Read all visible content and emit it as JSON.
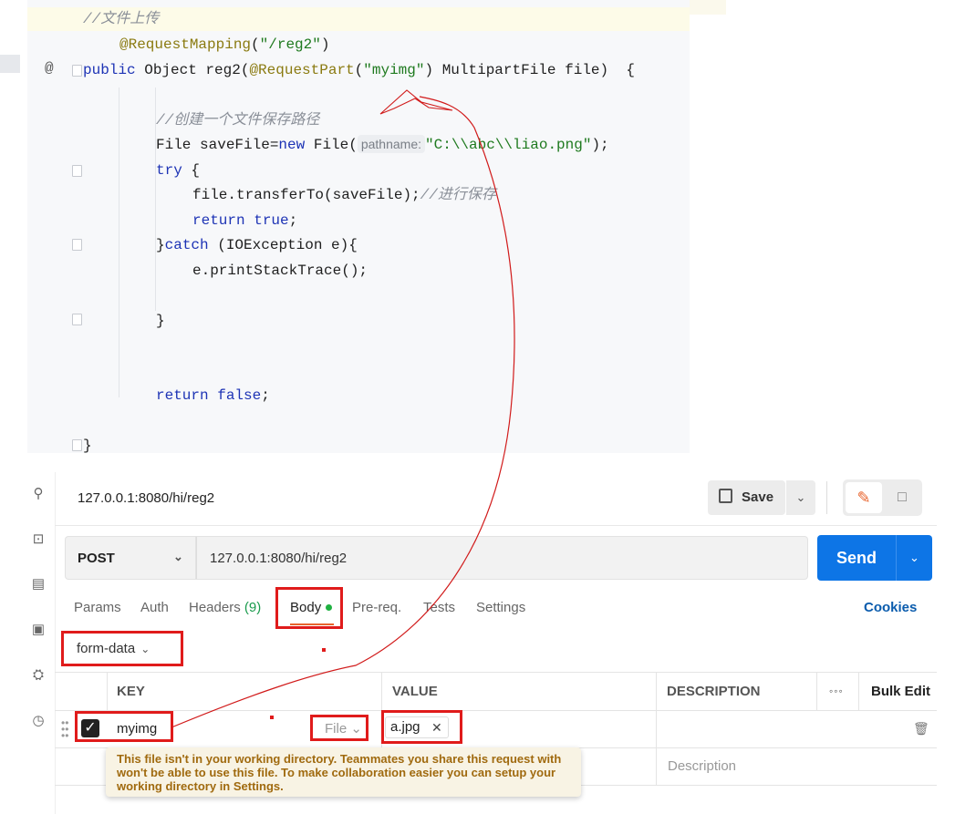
{
  "editor": {
    "comment_upload": "//文件上传",
    "mapping_annotation": "@RequestMapping",
    "mapping_path": "\"/reg2\"",
    "gutter_at": "@",
    "sig_public": "public",
    "sig_object": " Object reg2(",
    "sig_annotation": "@RequestPart",
    "sig_paren_open": "(",
    "sig_param_name": "\"myimg\"",
    "sig_rest": ") MultipartFile file)  {",
    "comment_path": "//创建一个文件保存路径",
    "line_file_a": "File saveFile=",
    "line_file_new": "new",
    "line_file_b": " File(",
    "hint_pathname": "pathname:",
    "line_file_str": "\"C:\\\\abc\\\\liao.png\"",
    "line_file_end": ");",
    "kw_try": "try",
    "brace_open": " {",
    "line_transfer": "file.transferTo(saveFile);",
    "comment_save": "//进行保存",
    "kw_return": "return",
    "kw_true": "true",
    "semi": ";",
    "close_catch_brace": "}",
    "kw_catch": "catch",
    "catch_rest": " (IOException e){",
    "line_print": "e.printStackTrace();",
    "close_brace_inner": "}",
    "kw_false": "false",
    "close_brace_outer": "}"
  },
  "postman": {
    "tab_url": "127.0.0.1:8080/hi/reg2",
    "save_label": "Save",
    "method": "POST",
    "url": "127.0.0.1:8080/hi/reg2",
    "send_label": "Send",
    "tabs": {
      "params": "Params",
      "auth": "Auth",
      "headers": "Headers",
      "headers_count": "(9)",
      "body": "Body",
      "prereq": "Pre-req.",
      "tests": "Tests",
      "settings": "Settings"
    },
    "cookies": "Cookies",
    "body_type": "form-data",
    "columns": {
      "key": "KEY",
      "value": "VALUE",
      "description": "DESCRIPTION",
      "bulk_edit": "Bulk Edit"
    },
    "row": {
      "key": "myimg",
      "type": "File",
      "file": "a.jpg"
    },
    "description_placeholder": "Description",
    "tooltip": "This file isn't in your working directory. Teammates you share this request with\nwon't be able to use this file. To make collaboration easier you can setup your\nworking directory in Settings."
  },
  "colors": {
    "accent_send": "#0d75e6",
    "annotation_red": "#e01b1b",
    "active_tab": "#e8632c"
  }
}
